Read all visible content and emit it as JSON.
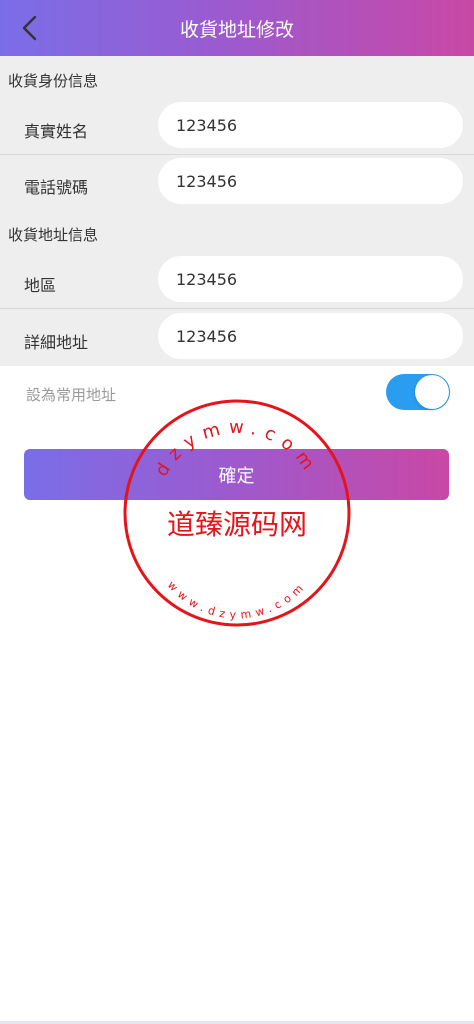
{
  "header": {
    "title": "收貨地址修改",
    "back_icon": "chevron-left-icon"
  },
  "sections": {
    "identity_title": "收貨身份信息",
    "address_title": "收貨地址信息"
  },
  "fields": [
    {
      "label": "真實姓名",
      "value": "123456"
    },
    {
      "label": "電話號碼",
      "value": "123456"
    },
    {
      "label": "地區",
      "value": "123456"
    },
    {
      "label": "詳細地址",
      "value": "123456"
    }
  ],
  "default_address": {
    "label": "設為常用地址",
    "enabled": true,
    "toggle_color": "#2b9df0"
  },
  "confirm_label": "確定",
  "watermark": {
    "top_ring": "dzymw.com",
    "center": "道臻源码网",
    "bottom_ring": "www.dzymw.com",
    "color": "#e5141b"
  },
  "colors": {
    "gradient_start": "#7a6ee8",
    "gradient_end": "#c948a6"
  }
}
